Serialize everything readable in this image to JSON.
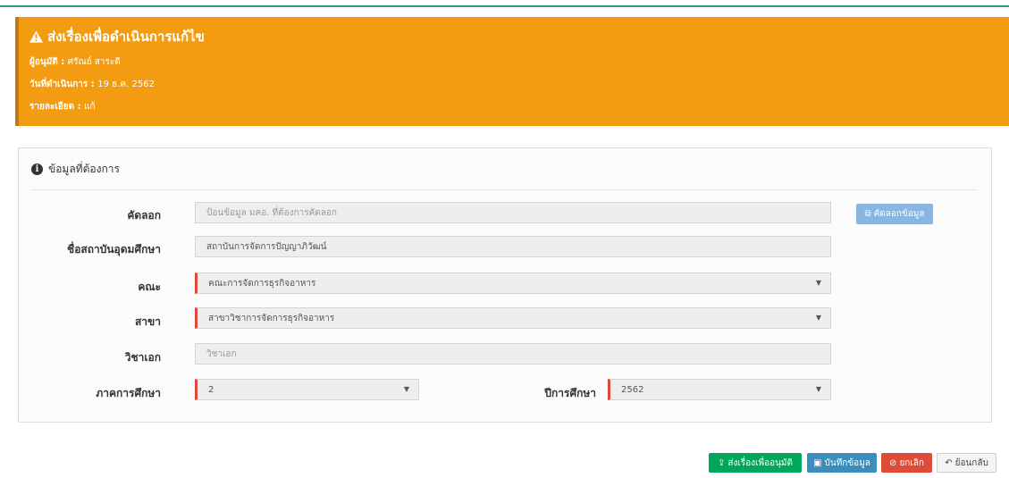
{
  "alert": {
    "title": "ส่งเรื่องเพื่อดำเนินการแก้ไข",
    "approver_label": "ผู้อนุมัติ :",
    "approver_value": "ศรัณย์ สาระดี",
    "date_label": "วันที่ดำเนินการ :",
    "date_value": "19 ธ.ค. 2562",
    "detail_label": "รายละเอียด :",
    "detail_value": "แก้"
  },
  "section": {
    "title": "ข้อมูลที่ต้องการ"
  },
  "form": {
    "copy_label": "คัดลอก",
    "copy_placeholder": "ป้อนข้อมูล มคอ. ที่ต้องการคัดลอก",
    "copy_button": "คัดลอกข้อมูล",
    "institution_label": "ชื่อสถาบันอุดมศึกษา",
    "institution_value": "สถาบันการจัดการปัญญาภิวัฒน์",
    "faculty_label": "คณะ",
    "faculty_value": "คณะการจัดการธุรกิจอาหาร",
    "branch_label": "สาขา",
    "branch_value": "สาขาวิชาการจัดการธุรกิจอาหาร",
    "major_label": "วิชาเอก",
    "major_placeholder": "วิชาเอก",
    "semester_label": "ภาคการศึกษา",
    "semester_value": "2",
    "year_label": "ปีการศึกษา",
    "year_value": "2562"
  },
  "actions": {
    "send": "ส่งเรื่องเพื่ออนุมัติ",
    "save": "บันทึกข้อมูล",
    "cancel": "ยกเลิก",
    "back": "ย้อนกลับ"
  },
  "colors": {
    "alert_bg": "#f39c12",
    "success": "#00a65a",
    "primary": "#3c8dbc",
    "danger": "#dd4b39",
    "copy_button": "#87b6e3"
  }
}
